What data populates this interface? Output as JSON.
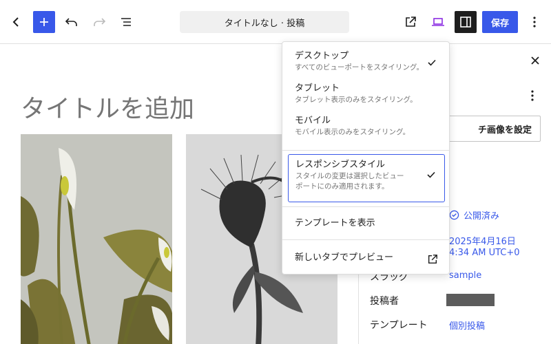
{
  "toolbar": {
    "document_title": "タイトルなし · 投稿",
    "save_label": "保存",
    "icons": [
      "back-icon",
      "add-icon",
      "undo-icon",
      "redo-icon",
      "list-view-icon",
      "external-link-icon",
      "desktop-icon",
      "sidebar-icon",
      "more-vertical-icon"
    ]
  },
  "canvas": {
    "title_placeholder": "タイトルを追加"
  },
  "sidebar": {
    "featured_image_label": "チ画像を設定",
    "status_value": "公開済み",
    "date_value_line1": "2025年4月16日",
    "date_value_line2": "4:34 AM UTC+0",
    "slug_label": "スラッグ",
    "slug_value": "sample",
    "author_label": "投稿者",
    "template_label": "テンプレート",
    "template_value": "個別投稿"
  },
  "menu": {
    "items": [
      {
        "title": "デスクトップ",
        "desc": "すべてのビューポートをスタイリング。",
        "checked": true
      },
      {
        "title": "タブレット",
        "desc": "タブレット表示のみをスタイリング。",
        "checked": false
      },
      {
        "title": "モバイル",
        "desc": "モバイル表示のみをスタイリング。",
        "checked": false
      }
    ],
    "responsive": {
      "title": "レスポンシブスタイル",
      "desc_line1": "スタイルの変更は選択したビュー",
      "desc_line2": "ポートにのみ適用されます。",
      "checked": true
    },
    "show_template": "テンプレートを表示",
    "preview_new_tab": "新しいタブでプレビュー"
  },
  "colors": {
    "accent": "#3858e9",
    "text": "#1e1e1e",
    "muted": "#757575"
  }
}
